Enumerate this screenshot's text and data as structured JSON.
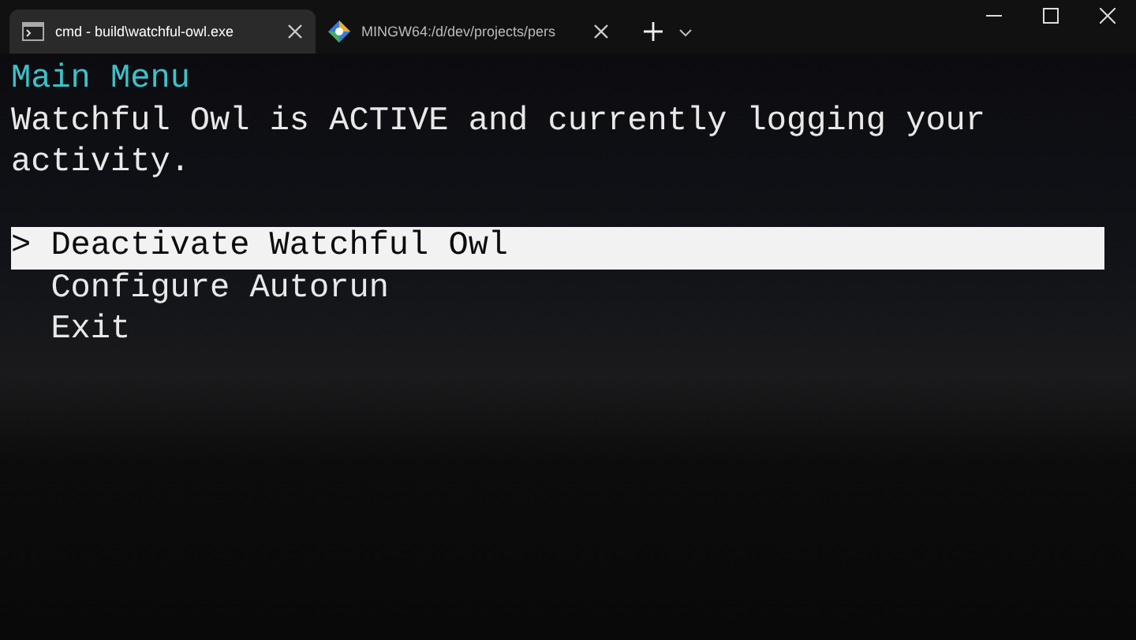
{
  "tabs": [
    {
      "title": "cmd - build\\watchful-owl.exe",
      "kind": "cmd",
      "selected": true
    },
    {
      "title": "MINGW64:/d/dev/projects/pers",
      "kind": "git",
      "selected": false
    }
  ],
  "terminal": {
    "heading": "Main Menu",
    "status_lines": [
      "Watchful Owl is ACTIVE and currently logging your",
      "activity."
    ],
    "cursor": ">",
    "menu": [
      {
        "label": "Deactivate Watchful Owl",
        "selected": true
      },
      {
        "label": "Configure Autorun",
        "selected": false
      },
      {
        "label": "Exit",
        "selected": false
      }
    ]
  }
}
